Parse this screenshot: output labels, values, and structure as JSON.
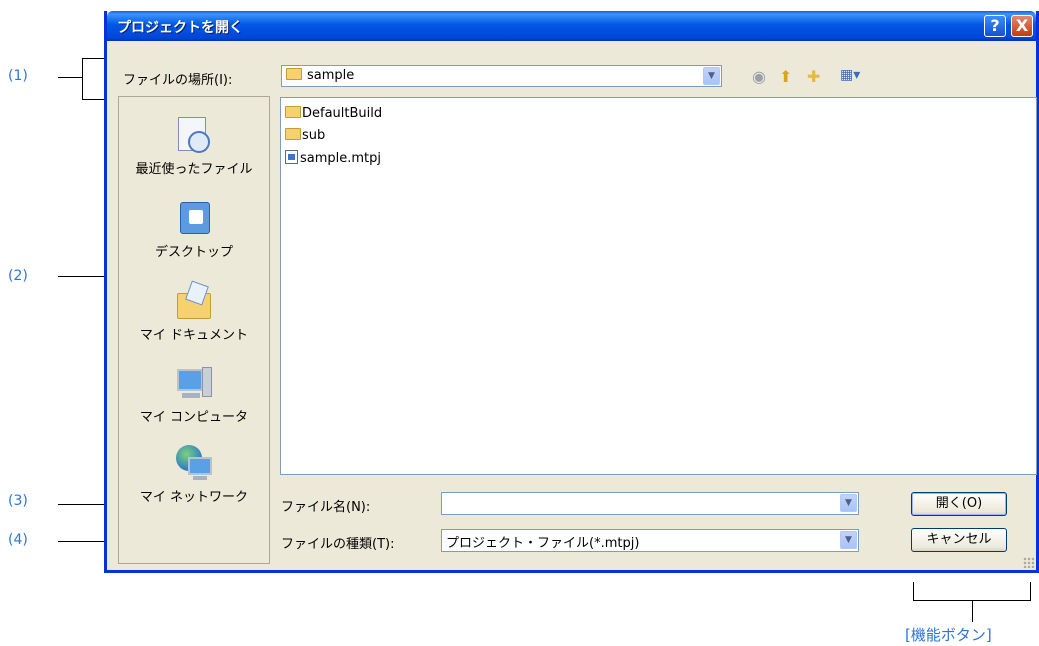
{
  "annotations": {
    "label_1": "(1)",
    "label_2": "(2)",
    "label_3": "(3)",
    "label_4": "(4)",
    "function_buttons": "[機能ボタン]"
  },
  "dialog": {
    "title": "プロジェクトを開く",
    "help_button": "?",
    "close_button": "X",
    "look_in_label": "ファイルの場所(I):",
    "look_in_value": "sample",
    "toolbar_icons": [
      "back-icon",
      "up-folder-icon",
      "new-folder-icon",
      "view-menu-icon"
    ]
  },
  "places": [
    {
      "label": "最近使ったファイル",
      "icon": "recent-files-icon"
    },
    {
      "label": "デスクトップ",
      "icon": "desktop-icon"
    },
    {
      "label": "マイ ドキュメント",
      "icon": "my-documents-icon"
    },
    {
      "label": "マイ コンピュータ",
      "icon": "my-computer-icon"
    },
    {
      "label": "マイ ネットワーク",
      "icon": "my-network-icon"
    }
  ],
  "files": [
    {
      "name": "DefaultBuild",
      "type": "folder"
    },
    {
      "name": "sub",
      "type": "folder"
    },
    {
      "name": "sample.mtpj",
      "type": "file"
    }
  ],
  "filename": {
    "label": "ファイル名(N):",
    "value": ""
  },
  "filetype": {
    "label": "ファイルの種類(T):",
    "value": "プロジェクト・ファイル(*.mtpj)"
  },
  "buttons": {
    "open": "開く(O)",
    "cancel": "キャンセル"
  },
  "colors": {
    "annotation": "#2e75d6",
    "titlebar": "#0258e6",
    "window_bg": "#ece9d8"
  }
}
